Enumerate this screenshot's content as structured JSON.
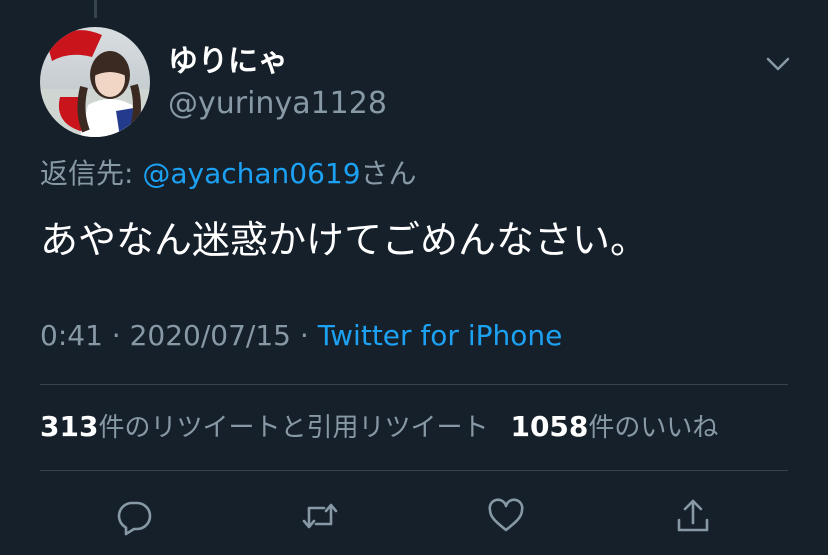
{
  "tweet": {
    "author": {
      "display_name": "ゆりにゃ",
      "handle": "@yurinya1128"
    },
    "reply_prefix": "返信先: ",
    "reply_mention": "@ayachan0619",
    "reply_suffix": "さん",
    "text": "あやなん迷惑かけてごめんなさい。",
    "time": "0:41",
    "separator": " · ",
    "date": "2020/07/15",
    "source": "Twitter for iPhone"
  },
  "stats": {
    "retweets_count": "313",
    "retweets_label": "件のリツイートと引用リツイート",
    "likes_count": "1058",
    "likes_label": "件のいいね"
  },
  "actions": {
    "icons": [
      "reply-icon",
      "retweet-icon",
      "like-icon",
      "share-icon"
    ]
  },
  "colors": {
    "background": "#15202b",
    "accent": "#1da1f2",
    "secondary_text": "#8899a6",
    "divider": "#38444d"
  }
}
